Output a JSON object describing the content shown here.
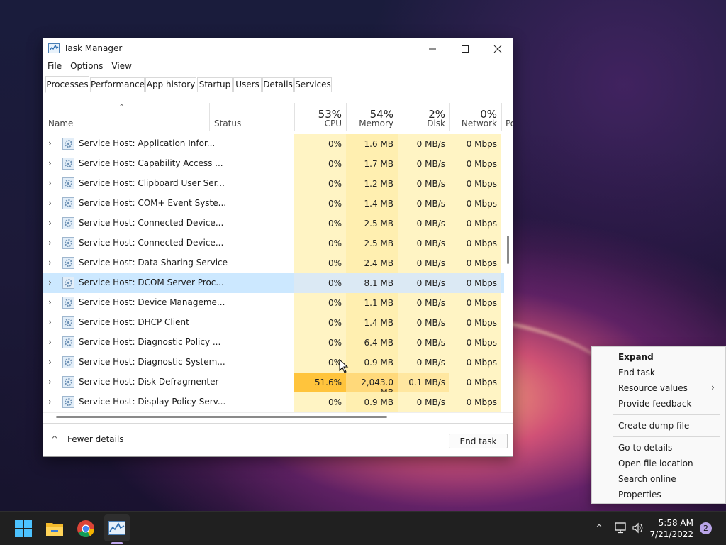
{
  "window": {
    "title": "Task Manager",
    "menu": [
      "File",
      "Options",
      "View"
    ],
    "tabs": [
      "Processes",
      "Performance",
      "App history",
      "Startup",
      "Users",
      "Details",
      "Services"
    ],
    "active_tab": "Processes"
  },
  "columns": {
    "name": "Name",
    "status": "Status",
    "cpu": {
      "label": "CPU",
      "percent": "53%"
    },
    "memory": {
      "label": "Memory",
      "percent": "54%"
    },
    "disk": {
      "label": "Disk",
      "percent": "2%"
    },
    "network": {
      "label": "Network",
      "percent": "0%"
    },
    "power_partial": "Po"
  },
  "processes": [
    {
      "name": "Service Host: Application Infor...",
      "cpu": "0%",
      "memory": "1.6 MB",
      "disk": "0 MB/s",
      "network": "0 Mbps"
    },
    {
      "name": "Service Host: Capability Access ...",
      "cpu": "0%",
      "memory": "1.7 MB",
      "disk": "0 MB/s",
      "network": "0 Mbps"
    },
    {
      "name": "Service Host: Clipboard User Ser...",
      "cpu": "0%",
      "memory": "1.2 MB",
      "disk": "0 MB/s",
      "network": "0 Mbps"
    },
    {
      "name": "Service Host: COM+ Event Syste...",
      "cpu": "0%",
      "memory": "1.4 MB",
      "disk": "0 MB/s",
      "network": "0 Mbps"
    },
    {
      "name": "Service Host: Connected Device...",
      "cpu": "0%",
      "memory": "2.5 MB",
      "disk": "0 MB/s",
      "network": "0 Mbps"
    },
    {
      "name": "Service Host: Connected Device...",
      "cpu": "0%",
      "memory": "2.5 MB",
      "disk": "0 MB/s",
      "network": "0 Mbps"
    },
    {
      "name": "Service Host: Data Sharing Service",
      "cpu": "0%",
      "memory": "2.4 MB",
      "disk": "0 MB/s",
      "network": "0 Mbps"
    },
    {
      "name": "Service Host: DCOM Server Proc...",
      "cpu": "0%",
      "memory": "8.1 MB",
      "disk": "0 MB/s",
      "network": "0 Mbps",
      "selected": true
    },
    {
      "name": "Service Host: Device Manageme...",
      "cpu": "0%",
      "memory": "1.1 MB",
      "disk": "0 MB/s",
      "network": "0 Mbps"
    },
    {
      "name": "Service Host: DHCP Client",
      "cpu": "0%",
      "memory": "1.4 MB",
      "disk": "0 MB/s",
      "network": "0 Mbps"
    },
    {
      "name": "Service Host: Diagnostic Policy ...",
      "cpu": "0%",
      "memory": "6.4 MB",
      "disk": "0 MB/s",
      "network": "0 Mbps"
    },
    {
      "name": "Service Host: Diagnostic System...",
      "cpu": "0%",
      "memory": "0.9 MB",
      "disk": "0 MB/s",
      "network": "0 Mbps"
    },
    {
      "name": "Service Host: Disk Defragmenter",
      "cpu": "51.6%",
      "memory": "2,043.0 MB",
      "disk": "0.1 MB/s",
      "network": "0 Mbps",
      "hot": true
    },
    {
      "name": "Service Host: Display Policy Serv...",
      "cpu": "0%",
      "memory": "0.9 MB",
      "disk": "0 MB/s",
      "network": "0 Mbps"
    }
  ],
  "footer": {
    "fewer_details": "Fewer details",
    "end_task": "End task"
  },
  "context_menu": {
    "expand": "Expand",
    "end_task": "End task",
    "resource_values": "Resource values",
    "provide_feedback": "Provide feedback",
    "create_dump_file": "Create dump file",
    "go_to_details": "Go to details",
    "open_file_location": "Open file location",
    "search_online": "Search online",
    "properties": "Properties"
  },
  "taskbar": {
    "time": "5:58 AM",
    "date": "7/21/2022",
    "notification_count": "2"
  },
  "colors": {
    "selected_row": "#cce8ff",
    "heat_low": "#fff4c4",
    "heat_high_cpu": "#ffc43c",
    "heat_high_mem": "#ffd97a",
    "taskbar": "#202020"
  },
  "icons": [
    "task-manager-icon",
    "gear-icon",
    "chevron-right-icon",
    "chevron-up-icon",
    "windows-start-icon",
    "file-explorer-icon",
    "chrome-icon",
    "network-icon",
    "volume-icon"
  ]
}
